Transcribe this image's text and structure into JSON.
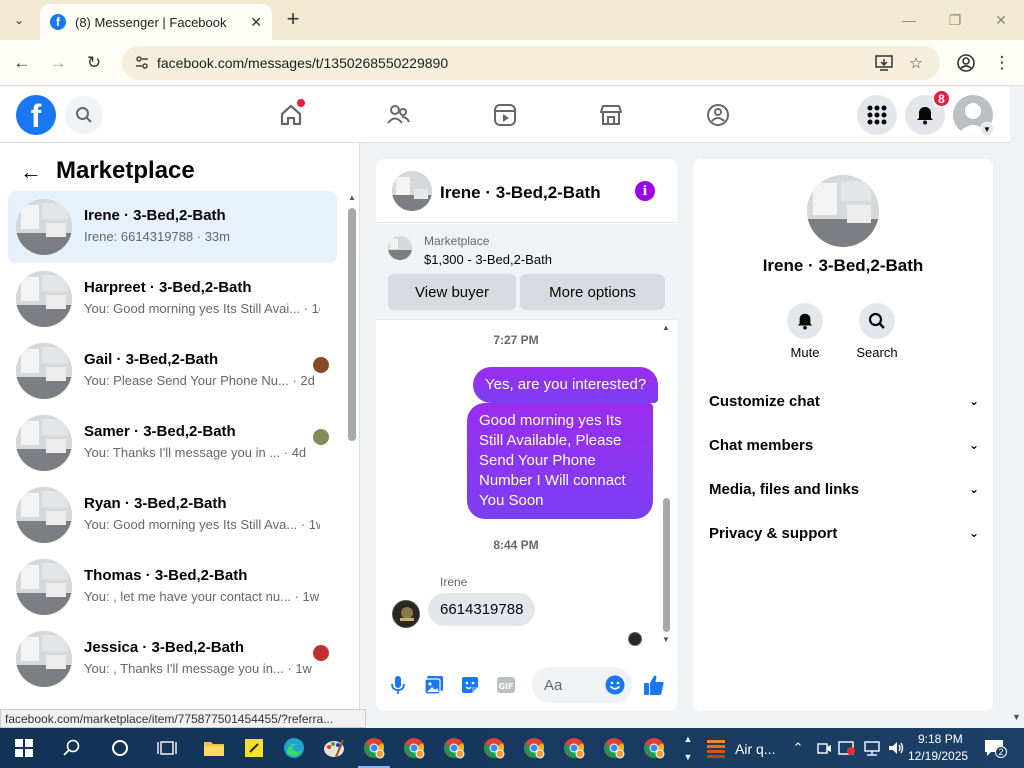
{
  "browser": {
    "tab_title": "(8) Messenger | Facebook",
    "url": "facebook.com/messages/t/1350268550229890",
    "status_url": "facebook.com/marketplace/item/775877501454455/?referra..."
  },
  "header": {
    "notifications_count": "8"
  },
  "sidebar": {
    "title": "Marketplace",
    "chats": [
      {
        "name": "Irene · 3-Bed,2-Bath",
        "preview": "Irene: 6614319788 · 33m",
        "active": true
      },
      {
        "name": "Harpreet · 3-Bed,2-Bath",
        "preview": "You: Good morning yes Its Still Avai... · 1d"
      },
      {
        "name": "Gail · 3-Bed,2-Bath",
        "preview": "You: Please Send Your Phone Nu... · 2d"
      },
      {
        "name": "Samer · 3-Bed,2-Bath",
        "preview": "You: Thanks I'll message you in ... · 4d"
      },
      {
        "name": "Ryan · 3-Bed,2-Bath",
        "preview": "You: Good morning yes Its Still Ava... · 1w"
      },
      {
        "name": "Thomas · 3-Bed,2-Bath",
        "preview": "You: , let me have your contact nu... · 1w"
      },
      {
        "name": "Jessica · 3-Bed,2-Bath",
        "preview": "You: , Thanks I'll message you in... · 1w"
      }
    ]
  },
  "conversation": {
    "title": "Irene · 3-Bed,2-Bath",
    "marketplace_label": "Marketplace",
    "listing": "$1,300 - 3-Bed,2-Bath",
    "view_buyer_label": "View buyer",
    "more_options_label": "More options",
    "timestamp1": "7:27 PM",
    "msg_out1": "Yes, are you interested?",
    "msg_out2": "Good morning yes Its Still Available, Please Send Your Phone Number I Will connact You Soon",
    "timestamp2": "8:44 PM",
    "sender": "Irene",
    "msg_in1": "6614319788",
    "composer_placeholder": "Aa"
  },
  "details": {
    "name": "Irene · 3-Bed,2-Bath",
    "mute_label": "Mute",
    "search_label": "Search",
    "sections": [
      "Customize chat",
      "Chat members",
      "Media, files and links",
      "Privacy & support"
    ]
  },
  "taskbar": {
    "weather": "Air q...",
    "time": "9:18 PM",
    "date": "12/19/2025",
    "notif_count": "2"
  },
  "colors": {
    "fb_blue": "#1877f2",
    "messenger_purple": "#8a2be2",
    "badge_red": "#e41e3f"
  }
}
